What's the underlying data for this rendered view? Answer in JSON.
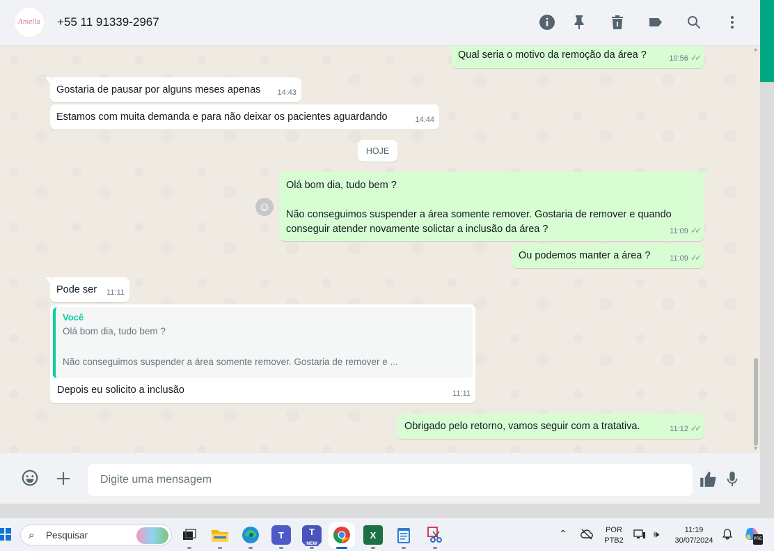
{
  "header": {
    "avatar_text": "Amella",
    "contact": "+55 11 91339-2967",
    "icons": [
      "info-icon",
      "pin-icon",
      "delete-icon",
      "label-icon",
      "search-icon",
      "menu-icon"
    ]
  },
  "messages": [
    {
      "dir": "out",
      "text": "Qual seria o motivo da remoção da área ?",
      "time": "10:56",
      "ticks": "✓✓"
    },
    {
      "dir": "in",
      "text": "Gostaria de pausar por alguns meses apenas",
      "time": "14:43"
    },
    {
      "dir": "in",
      "text": "Estamos com muita demanda e para não deixar os pacientes aguardando",
      "time": "14:44"
    },
    {
      "dir": "out",
      "text": "Olá bom dia, tudo bem ?\n\nNão conseguimos suspender a área somente remover. Gostaria de remover e quando\nconseguir atender novamente solictar a inclusão da área ?",
      "time": "11:09",
      "ticks": "✓✓"
    },
    {
      "dir": "out",
      "text": "Ou podemos manter a área ?",
      "time": "11:09",
      "ticks": "✓✓"
    },
    {
      "dir": "in",
      "text": "Pode ser",
      "time": "11:11"
    },
    {
      "dir": "in",
      "text": "Depois eu solicito a inclusão",
      "time": "11:11",
      "quote": {
        "author": "Você",
        "text": "Olá bom dia, tudo bem ?\n\nNão conseguimos suspender a área somente remover. Gostaria de remover e ..."
      }
    },
    {
      "dir": "out",
      "text": "Obrigado pelo retorno, vamos seguir com a tratativa.",
      "time": "11:12",
      "ticks": "✓✓"
    }
  ],
  "date_chip": "HOJE",
  "reaction_icon": "☺",
  "compose": {
    "placeholder": "Digite uma mensagem"
  },
  "taskbar": {
    "search_label": "Pesquisar",
    "apps": [
      "task-view",
      "file-explorer",
      "edge",
      "teams",
      "teams-new",
      "chrome",
      "excel",
      "notepad",
      "snipping-tool"
    ],
    "teams_new_badge": "NEW",
    "language_line1": "POR",
    "language_line2": "PTB2",
    "time": "11:19",
    "date": "30/07/2024",
    "copilot_badge": "PRE"
  },
  "colors": {
    "accent": "#00a884",
    "bubble_out": "#d9fdd3",
    "bubble_in": "#ffffff",
    "chat_bg": "#efeae2",
    "quote_bar": "#06cf9c"
  }
}
